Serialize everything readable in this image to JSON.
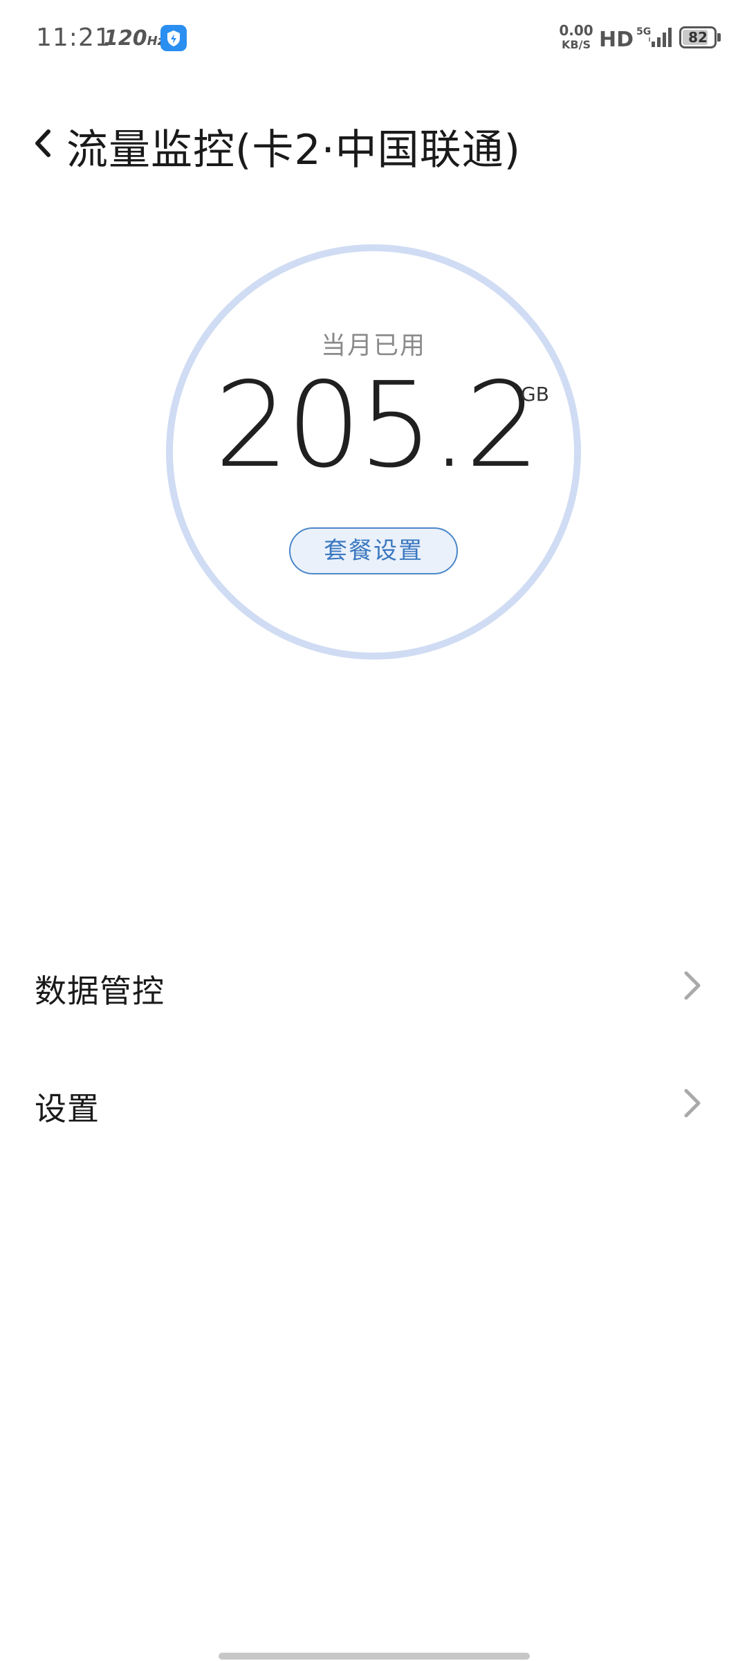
{
  "status_bar": {
    "time": "11:21",
    "refresh_rate": "120",
    "refresh_unit": "Hz",
    "net_speed_value": "0.00",
    "net_speed_unit": "KB/S",
    "hd_label": "HD",
    "network_type": "5G",
    "battery_level": 82,
    "battery_text": "82",
    "app_icon": "security-app-icon"
  },
  "header": {
    "back_icon": "chevron-left-icon",
    "title": "流量监控(卡2·中国联通)"
  },
  "usage": {
    "label": "当月已用",
    "value": "205.2",
    "unit": "GB",
    "plan_settings_label": "套餐设置",
    "ring_color": "#cfdcf3",
    "accent_color": "#3b78c0"
  },
  "menu": {
    "items": [
      {
        "label": "数据管控",
        "icon": "chevron-right-icon"
      },
      {
        "label": "设置",
        "icon": "chevron-right-icon"
      }
    ]
  }
}
